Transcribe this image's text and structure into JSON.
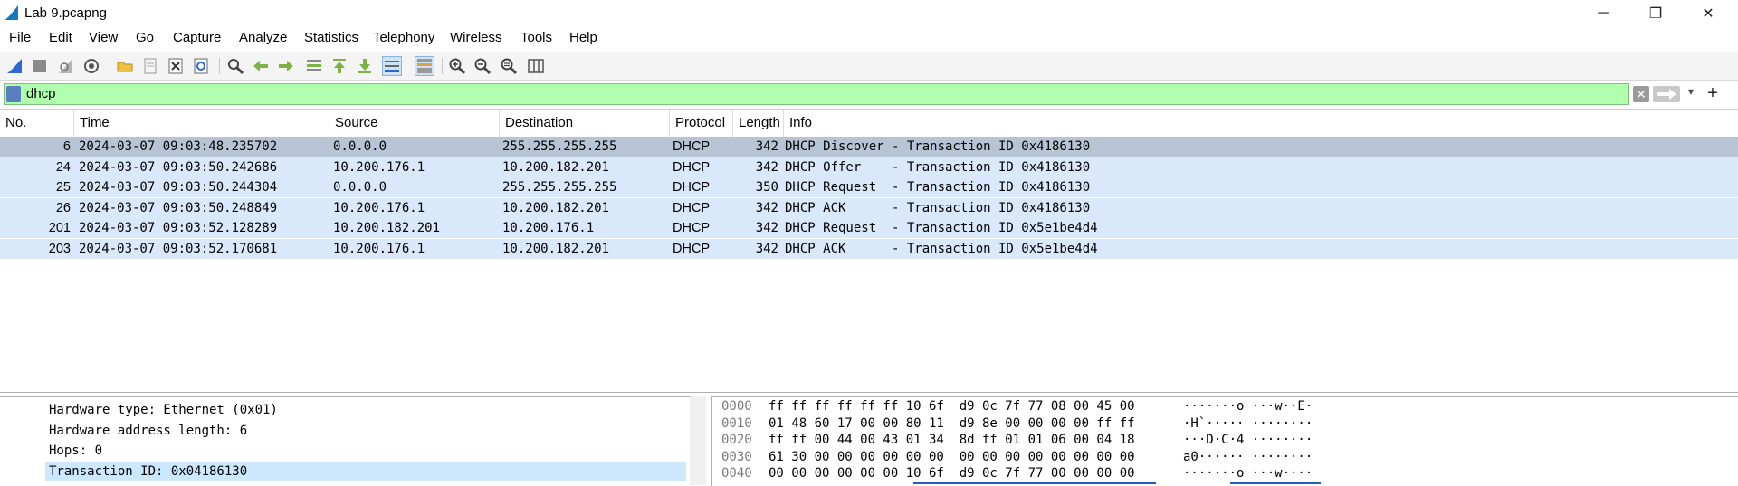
{
  "window": {
    "title": "Lab 9.pcapng",
    "minimize": "─",
    "restore": "❐",
    "close": "✕"
  },
  "menu": [
    "File",
    "Edit",
    "View",
    "Go",
    "Capture",
    "Analyze",
    "Statistics",
    "Telephony",
    "Wireless",
    "Tools",
    "Help"
  ],
  "toolbar": {
    "icons": [
      "start-capture-icon",
      "stop-capture-icon",
      "restart-capture-icon",
      "capture-options-icon",
      "open-file-icon",
      "save-file-icon",
      "close-file-icon",
      "reload-file-icon",
      "find-packet-icon",
      "go-back-icon",
      "go-forward-icon",
      "go-to-packet-icon",
      "go-first-icon",
      "go-last-icon",
      "autoscroll-icon",
      "colorize-icon",
      "zoom-in-icon",
      "zoom-out-icon",
      "zoom-reset-icon",
      "resize-columns-icon"
    ]
  },
  "filter": {
    "value": "dhcp",
    "clear": "✕",
    "dropdown": "▾",
    "add": "+"
  },
  "packet_list": {
    "columns": [
      "No.",
      "Time",
      "Source",
      "Destination",
      "Protocol",
      "Length",
      "Info"
    ],
    "rows": [
      {
        "no": "6",
        "time": "2024-03-07 09:03:48.235702",
        "source": "0.0.0.0",
        "destination": "255.255.255.255",
        "protocol": "DHCP",
        "length": "342",
        "info": "DHCP Discover - Transaction ID 0x4186130"
      },
      {
        "no": "24",
        "time": "2024-03-07 09:03:50.242686",
        "source": "10.200.176.1",
        "destination": "10.200.182.201",
        "protocol": "DHCP",
        "length": "342",
        "info": "DHCP Offer    - Transaction ID 0x4186130"
      },
      {
        "no": "25",
        "time": "2024-03-07 09:03:50.244304",
        "source": "0.0.0.0",
        "destination": "255.255.255.255",
        "protocol": "DHCP",
        "length": "350",
        "info": "DHCP Request  - Transaction ID 0x4186130"
      },
      {
        "no": "26",
        "time": "2024-03-07 09:03:50.248849",
        "source": "10.200.176.1",
        "destination": "10.200.182.201",
        "protocol": "DHCP",
        "length": "342",
        "info": "DHCP ACK      - Transaction ID 0x4186130"
      },
      {
        "no": "201",
        "time": "2024-03-07 09:03:52.128289",
        "source": "10.200.182.201",
        "destination": "10.200.176.1",
        "protocol": "DHCP",
        "length": "342",
        "info": "DHCP Request  - Transaction ID 0x5e1be4d4"
      },
      {
        "no": "203",
        "time": "2024-03-07 09:03:52.170681",
        "source": "10.200.176.1",
        "destination": "10.200.182.201",
        "protocol": "DHCP",
        "length": "342",
        "info": "DHCP ACK      - Transaction ID 0x5e1be4d4"
      }
    ],
    "selected_index": 0,
    "row_color": "#dae8fb",
    "selected_color": "#b7c4d6"
  },
  "details": {
    "lines": [
      "Hardware type: Ethernet (0x01)",
      "Hardware address length: 6",
      "Hops: 0",
      "Transaction ID: 0x04186130"
    ],
    "selected_index": 3
  },
  "bytes": {
    "lines": [
      {
        "offset": "0000",
        "hex": "ff ff ff ff ff ff 10 6f  d9 0c 7f 77 08 00 45 00",
        "ascii": "·······o ···w··E·"
      },
      {
        "offset": "0010",
        "hex": "01 48 60 17 00 00 80 11  d9 8e 00 00 00 00 ff ff",
        "ascii": "·H`····· ········"
      },
      {
        "offset": "0020",
        "hex": "ff ff 00 44 00 43 01 34  8d ff 01 01 06 00 04 18",
        "ascii": "···D·C·4 ········"
      },
      {
        "offset": "0030",
        "hex": "61 30 00 00 00 00 00 00  00 00 00 00 00 00 00 00",
        "ascii": "a0······ ········"
      },
      {
        "offset": "0040",
        "hex": "00 00 00 00 00 00 10 6f  d9 0c 7f 77 00 00 00 00",
        "ascii": "·······o ···w····"
      }
    ]
  },
  "colors": {
    "filter_valid": "#afffaf",
    "detail_selected": "#cce8ff",
    "hex_highlight": "#1e5fbf"
  }
}
